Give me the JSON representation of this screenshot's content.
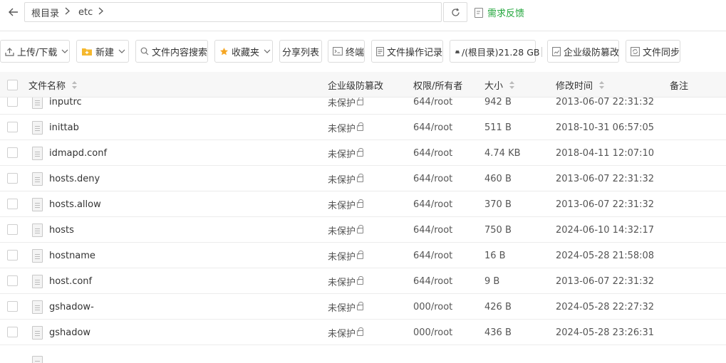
{
  "address": {
    "back_icon": "arrow-left-icon",
    "path": [
      "根目录",
      "etc"
    ],
    "refresh_icon": "refresh-icon",
    "feedback_label": "需求反馈",
    "feedback_color": "#20a53a"
  },
  "toolbar": {
    "upload_download": "上传/下载",
    "new": "新建",
    "content_search": "文件内容搜索",
    "favorites": "收藏夹",
    "share_list": "分享列表",
    "terminal": "终端",
    "op_log": "文件操作记录",
    "disk": "/(根目录)21.28 GB",
    "tamper": "企业级防篡改",
    "sync": "文件同步"
  },
  "table": {
    "columns": {
      "name": "文件名称",
      "tamper": "企业级防篡改",
      "perm": "权限/所有者",
      "size": "大小",
      "mtime": "修改时间",
      "note": "备注"
    },
    "rows": [
      {
        "name": "inputrc",
        "tamper": "未保护",
        "perm": "644/root",
        "size": "942 B",
        "mtime": "2013-06-07 22:31:32"
      },
      {
        "name": "inittab",
        "tamper": "未保护",
        "perm": "644/root",
        "size": "511 B",
        "mtime": "2018-10-31 06:57:05"
      },
      {
        "name": "idmapd.conf",
        "tamper": "未保护",
        "perm": "644/root",
        "size": "4.74 KB",
        "mtime": "2018-04-11 12:07:10"
      },
      {
        "name": "hosts.deny",
        "tamper": "未保护",
        "perm": "644/root",
        "size": "460 B",
        "mtime": "2013-06-07 22:31:32"
      },
      {
        "name": "hosts.allow",
        "tamper": "未保护",
        "perm": "644/root",
        "size": "370 B",
        "mtime": "2013-06-07 22:31:32"
      },
      {
        "name": "hosts",
        "tamper": "未保护",
        "perm": "644/root",
        "size": "750 B",
        "mtime": "2024-06-10 14:32:17"
      },
      {
        "name": "hostname",
        "tamper": "未保护",
        "perm": "644/root",
        "size": "16 B",
        "mtime": "2024-05-28 21:58:08"
      },
      {
        "name": "host.conf",
        "tamper": "未保护",
        "perm": "644/root",
        "size": "9 B",
        "mtime": "2013-06-07 22:31:32"
      },
      {
        "name": "gshadow-",
        "tamper": "未保护",
        "perm": "000/root",
        "size": "426 B",
        "mtime": "2024-05-28 22:27:32"
      },
      {
        "name": "gshadow",
        "tamper": "未保护",
        "perm": "000/root",
        "size": "436 B",
        "mtime": "2024-05-28 23:26:31"
      }
    ]
  }
}
